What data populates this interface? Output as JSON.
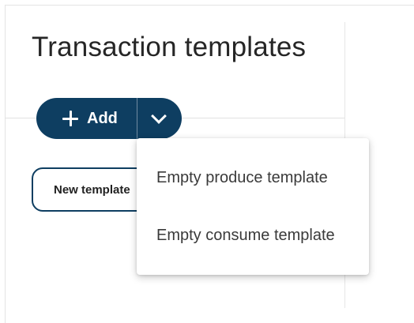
{
  "page": {
    "title": "Transaction templates"
  },
  "toolbar": {
    "add_label": "Add",
    "add_icon": "plus-icon",
    "dropdown_icon": "chevron-down-icon"
  },
  "templates": {
    "items": [
      {
        "label": "New template"
      }
    ]
  },
  "add_menu": {
    "items": [
      {
        "label": "Empty produce template"
      },
      {
        "label": "Empty consume template"
      }
    ]
  },
  "colors": {
    "primary": "#0e3e61",
    "text": "#262626"
  }
}
